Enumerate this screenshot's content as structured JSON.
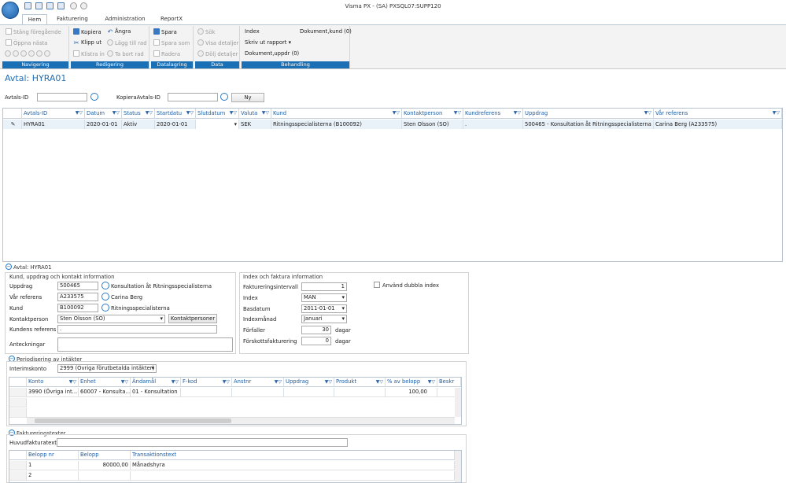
{
  "window": {
    "title": "Visma PX - (SA) PXSQL07:SUPP120"
  },
  "tabs": [
    "Hem",
    "Fakturering",
    "Administration",
    "ReportX"
  ],
  "ribbon": {
    "navigering": {
      "label": "Navigering",
      "items": [
        "Stäng föregående",
        "Öppna nästa"
      ]
    },
    "redigering": {
      "label": "Redigering",
      "kopiera": "Kopiera",
      "angra": "Ångra",
      "klipp": "Klipp ut",
      "lagg_till": "Lägg till rad",
      "klistra": "Klistra in",
      "ta_bort": "Ta bort rad"
    },
    "datalagring": {
      "label": "Datalagring",
      "spara": "Spara",
      "spara_som": "Spara som",
      "radera": "Radera"
    },
    "data": {
      "label": "Data",
      "sok": "Sök",
      "visa": "Visa detaljer",
      "dolj": "Dölj detaljer"
    },
    "behandling": {
      "label": "Behandling",
      "index": "Index",
      "dok_kund": "Dokument,kund (0)",
      "skriv_ut": "Skriv ut rapport",
      "dok_uppdr": "Dokument,uppdr (0)"
    }
  },
  "page": {
    "title": "Avtal: HYRA01"
  },
  "search": {
    "avtals_label": "Avtals-ID",
    "kopiera_label": "KopieraAvtals-ID",
    "ny": "Ny"
  },
  "grid": {
    "headers": [
      "Avtals-ID",
      "Datum",
      "Status",
      "Startdatu",
      "Slutdatum",
      "Valuta",
      "Kund",
      "Kontaktperson",
      "Kundreferens",
      "Uppdrag",
      "Vår referens"
    ],
    "row": [
      "HYRA01",
      "2020-01-01",
      "Aktiv",
      "2020-01-01",
      "",
      "SEK",
      "Ritningsspecialisterna (B100092)",
      "Sten Olsson (SO)",
      ".",
      "500465 - Konsultation åt Ritningsspecialisterna",
      "Carina Berg (A233575)"
    ]
  },
  "detail": {
    "title": "Avtal: HYRA01",
    "kund_section": "Kund, uppdrag och kontakt information",
    "uppdrag_label": "Uppdrag",
    "uppdrag_val": "500465",
    "uppdrag_name": "Konsultation åt Ritningsspecialisterna",
    "varref_label": "Vår referens",
    "varref_val": "A233575",
    "varref_name": "Carina Berg",
    "kund_label": "Kund",
    "kund_val": "B100092",
    "kund_name": "Ritningsspecialisterna",
    "kontakt_label": "Kontaktperson",
    "kontakt_val": "Sten Olsson (SO)",
    "kontakt_btn": "Kontaktpersoner",
    "kundref_label": "Kundens referens",
    "kundref_val": ".",
    "anteckningar_label": "Anteckningar",
    "index_section": "Index och faktura information",
    "fakt_int_label": "Faktureringsintervall",
    "fakt_int_val": "1",
    "index_label": "Index",
    "index_val": "MAN",
    "basdatum_label": "Basdatum",
    "basdatum_val": "2011-01-01",
    "indexmanad_label": "Indexmånad",
    "indexmanad_val": "Januari",
    "forfaller_label": "Förfaller",
    "forfaller_val": "30",
    "dagar": "dagar",
    "forskott_label": "Förskottsfakturering",
    "forskott_val": "0",
    "dubbla_label": "Använd dubbla index"
  },
  "periodisering": {
    "title": "Periodisering av intäkter",
    "interim_label": "Interimskonto",
    "interim_val": "2999 (Övriga förutbetalda intäkter)",
    "headers": [
      "Konto",
      "Enhet",
      "Ändamål",
      "F-kod",
      "Anstnr",
      "Uppdrag",
      "Produkt",
      "% av belopp",
      "Beskr"
    ],
    "row": [
      "3990 (Övriga int...",
      "60007 - Konsulta...",
      "01 - Konsultation",
      "",
      "",
      "",
      "",
      "100,00",
      ""
    ]
  },
  "fakturatext": {
    "title": "Faktureringstexter",
    "huvud_label": "Huvudfakturatext",
    "headers": [
      "Belopp nr",
      "Belopp",
      "Transaktionstext"
    ],
    "rows": [
      [
        "1",
        "80000,00",
        "Månadshyra"
      ],
      [
        "2",
        "",
        ""
      ]
    ]
  }
}
